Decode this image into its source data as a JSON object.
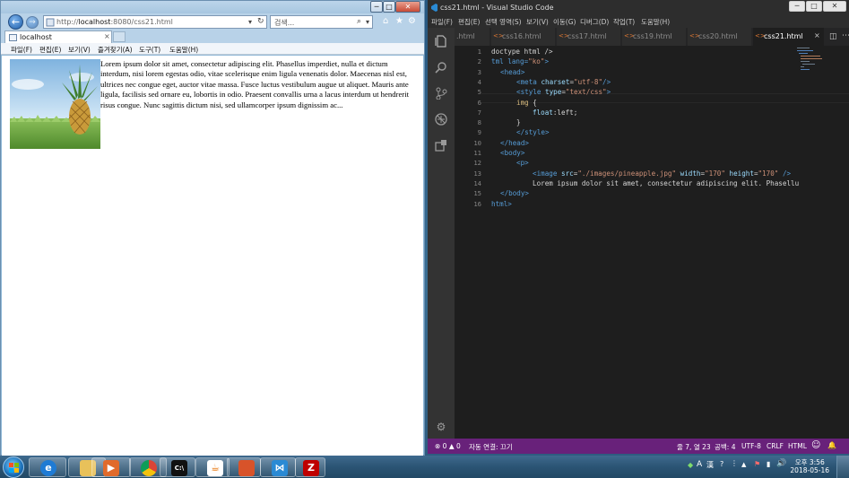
{
  "ie": {
    "address_prefix": "http://",
    "address_host": "localhost",
    "address_rest": ":8080/css21.html",
    "search_placeholder": "검색...",
    "tab_title": "localhost",
    "tab_close": "×",
    "menu": [
      "파일(F)",
      "편집(E)",
      "보기(V)",
      "즐겨찾기(A)",
      "도구(T)",
      "도움말(H)"
    ],
    "paragraph": "Lorem ipsum dolor sit amet, consectetur adipiscing elit. Phasellus imperdiet, nulla et dictum interdum, nisi lorem egestas odio, vitae scelerisque enim ligula venenatis dolor. Maecenas nisl est, ultrices nec congue eget, auctor vitae massa. Fusce luctus vestibulum augue ut aliquet. Mauris ante ligula, facilisis sed ornare eu, lobortis in odio. Praesent convallis urna a lacus interdum ut hendrerit risus congue. Nunc sagittis dictum nisi, sed ullamcorper ipsum dignissim ac..."
  },
  "vscode": {
    "title": "css21.html - Visual Studio Code",
    "menu": [
      "파일(F)",
      "편집(E)",
      "선택 영역(S)",
      "보기(V)",
      "이동(G)",
      "디버그(D)",
      "작업(T)",
      "도움말(H)"
    ],
    "tabs": [
      ".html",
      "css16.html",
      "css17.html",
      "css19.html",
      "css20.html",
      "css21.html"
    ],
    "active_tab": "css21.html",
    "tab_close": "×",
    "line_numbers": [
      "1",
      "2",
      "3",
      "4",
      "5",
      "6",
      "7",
      "8",
      "9",
      "10",
      "11",
      "12",
      "13",
      "14",
      "15",
      "16"
    ],
    "status": {
      "problems": "⊗ 0 ▲ 0",
      "live_share": "자동 연결: 끄기",
      "position": "줄 7, 열 23",
      "indent": "공백: 4",
      "encoding": "UTF-8",
      "eol": "CRLF",
      "language": "HTML",
      "smiley": "☺",
      "bell": "🔔"
    }
  },
  "code": {
    "l1": [
      "doctype html />"
    ],
    "l2": [
      "tml lang=",
      "\"ko\"",
      ">"
    ],
    "l3": [
      "<head>"
    ],
    "l4": [
      "<meta ",
      "charset",
      "=",
      "\"utf-8\"",
      "/>"
    ],
    "l5": [
      "<style ",
      "type",
      "=",
      "\"text/css\"",
      ">"
    ],
    "l6": [
      "img",
      " {"
    ],
    "l7": [
      "float",
      ":left;"
    ],
    "l8": [
      "}"
    ],
    "l9": [
      "</style>"
    ],
    "l10": [
      "</head>"
    ],
    "l11": [
      "<body>"
    ],
    "l12": [
      "<p>"
    ],
    "l13": [
      "<image ",
      "src",
      "=",
      "\"./images/pineapple.jpg\"",
      " width",
      "=",
      "\"170\"",
      " height",
      "=",
      "\"170\"",
      " />"
    ],
    "l14": [
      "Lorem ipsum dolor sit amet, consectetur adipiscing elit. Phasellu"
    ],
    "l15": [
      "</body>"
    ],
    "l16": [
      "html>"
    ]
  },
  "taskbar": {
    "time": "오후 3:56",
    "date": "2018-05-16",
    "ime": "A",
    "hanja": "漢"
  }
}
